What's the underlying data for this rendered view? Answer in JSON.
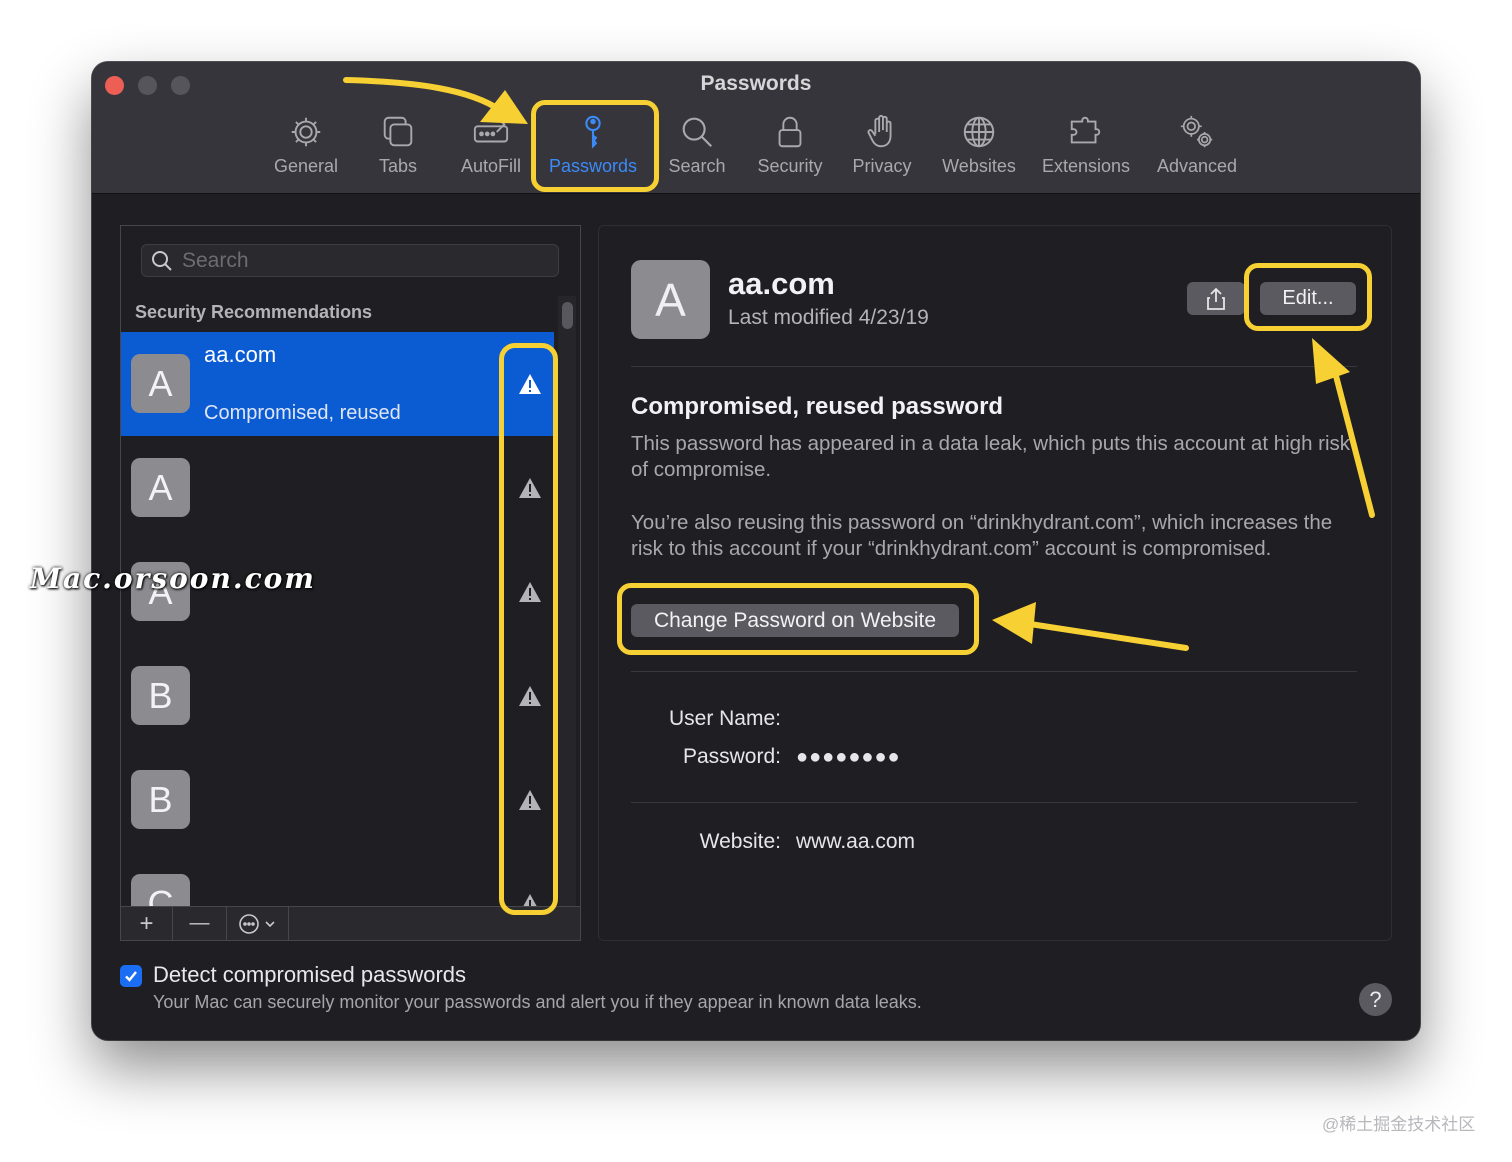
{
  "window": {
    "title": "Passwords"
  },
  "toolbar": {
    "items": [
      {
        "label": "General",
        "icon": "gear-icon"
      },
      {
        "label": "Tabs",
        "icon": "tabs-icon"
      },
      {
        "label": "AutoFill",
        "icon": "autofill-icon"
      },
      {
        "label": "Passwords",
        "icon": "key-icon",
        "active": true
      },
      {
        "label": "Search",
        "icon": "search-icon"
      },
      {
        "label": "Security",
        "icon": "lock-icon"
      },
      {
        "label": "Privacy",
        "icon": "hand-icon"
      },
      {
        "label": "Websites",
        "icon": "globe-icon"
      },
      {
        "label": "Extensions",
        "icon": "puzzle-icon"
      },
      {
        "label": "Advanced",
        "icon": "gears-icon"
      }
    ]
  },
  "sidebar": {
    "search_placeholder": "Search",
    "section_title": "Security Recommendations",
    "items": [
      {
        "initial": "A",
        "site": "aa.com",
        "status": "Compromised, reused",
        "selected": true
      },
      {
        "initial": "A",
        "site": "",
        "status": ""
      },
      {
        "initial": "A",
        "site": "",
        "status": ""
      },
      {
        "initial": "B",
        "site": "",
        "status": ""
      },
      {
        "initial": "B",
        "site": "",
        "status": ""
      },
      {
        "initial": "C",
        "site": "",
        "status": ""
      }
    ],
    "bottom_buttons": {
      "add": "+",
      "remove": "—",
      "more": "⋯"
    }
  },
  "detail": {
    "initial": "A",
    "title": "aa.com",
    "subtitle": "Last modified 4/23/19",
    "edit_label": "Edit...",
    "warning_title": "Compromised, reused password",
    "warning_body_1": "This password has appeared in a data leak, which puts this account at high risk of compromise.",
    "warning_body_2": "You’re also reusing this password on “drinkhydrant.com”, which increases the risk to this account if your “drinkhydrant.com” account is compromised.",
    "change_password_label": "Change Password on Website",
    "username_label": "User Name:",
    "username_value": "",
    "password_label": "Password:",
    "password_value": "●●●●●●●●",
    "website_label": "Website:",
    "website_value": "www.aa.com"
  },
  "footer": {
    "detect_label": "Detect compromised passwords",
    "detect_checked": true,
    "detect_description": "Your Mac can securely monitor your passwords and alert you if they appear in known data leaks.",
    "help_label": "?"
  },
  "watermarks": {
    "site": "Mac.orsoon.com",
    "credit": "@稀土掘金技术社区"
  },
  "colors": {
    "accent": "#3c8af7",
    "highlight": "#f7d034",
    "selected_row": "#0b5bd3"
  }
}
